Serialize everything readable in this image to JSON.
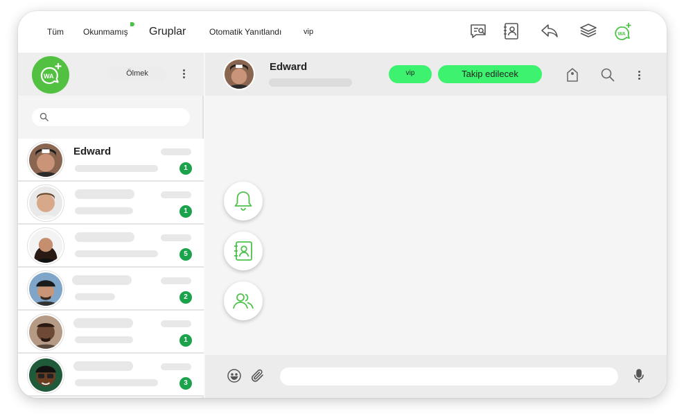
{
  "topbar": {
    "tabs": [
      {
        "label": "Tüm"
      },
      {
        "label": "Okunmamış"
      },
      {
        "label": "Gruplar"
      },
      {
        "label": "Otomatik Yanıtlandı"
      },
      {
        "label": "vip"
      }
    ],
    "icons": [
      "message-search-icon",
      "contact-book-icon",
      "reply-icon",
      "layers-icon",
      "wa-add-icon"
    ]
  },
  "sidebar": {
    "logo_text": "WA",
    "status_label": "Ölmek",
    "search": {
      "placeholder": "",
      "value": ""
    }
  },
  "chats": [
    {
      "name": "Edward",
      "unread": "1"
    },
    {
      "name": "",
      "unread": "1"
    },
    {
      "name": "",
      "unread": "5"
    },
    {
      "name": "",
      "unread": "2"
    },
    {
      "name": "",
      "unread": "1"
    },
    {
      "name": "",
      "unread": "3"
    }
  ],
  "conversation": {
    "name": "Edward",
    "tags": {
      "vip": "vip",
      "follow": "Takip edilecek"
    },
    "header_icons": [
      "tag-icon",
      "search-icon",
      "more-icon"
    ],
    "quick_actions": [
      "bell-icon",
      "contact-book-icon",
      "group-icon"
    ],
    "composer": {
      "placeholder": "",
      "value": ""
    }
  },
  "colors": {
    "brand_green": "#52c142",
    "badge_green": "#1aa34a",
    "tag_green": "#3cf26e",
    "icon_green": "#4cc24a"
  }
}
